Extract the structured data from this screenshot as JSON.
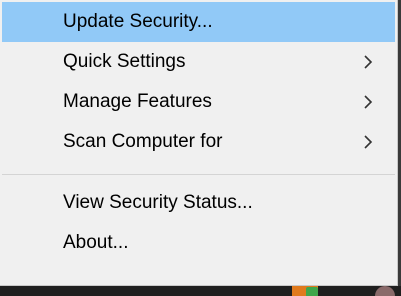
{
  "menu": {
    "items": [
      {
        "label": "Update Security...",
        "highlighted": true,
        "has_submenu": false
      },
      {
        "label": "Quick Settings",
        "highlighted": false,
        "has_submenu": true
      },
      {
        "label": "Manage Features",
        "highlighted": false,
        "has_submenu": true
      },
      {
        "label": "Scan Computer for",
        "highlighted": false,
        "has_submenu": true
      }
    ],
    "secondary_items": [
      {
        "label": "View Security Status..."
      },
      {
        "label": "About..."
      }
    ]
  },
  "colors": {
    "menu_background": "#f0f0f0",
    "highlight": "#91c9f7",
    "text": "#000000",
    "separator": "#d4d4d4"
  },
  "icons": {
    "submenu_arrow": "chevron-right-icon"
  }
}
